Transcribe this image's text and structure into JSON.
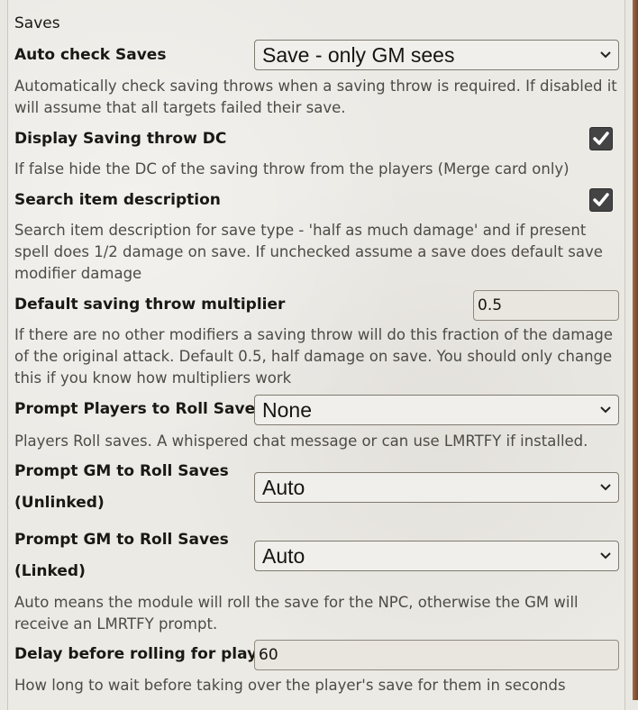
{
  "section": {
    "title": "Saves"
  },
  "settings": {
    "auto_check": {
      "label": "Auto check Saves",
      "value": "Save - only GM sees",
      "hint": "Automatically check saving throws when a saving throw is required. If disabled it will assume that all targets failed their save."
    },
    "display_dc": {
      "label": "Display Saving throw DC",
      "checked": true,
      "hint": "If false hide the DC of the saving throw from the players (Merge card only)"
    },
    "search_desc": {
      "label": "Search item description",
      "checked": true,
      "hint": "Search item description for save type - 'half as much damage' and if present spell does 1/2 damage on save. If unchecked assume a save does default save modifier damage"
    },
    "default_multiplier": {
      "label": "Default saving throw multiplier",
      "value": "0.5",
      "hint": "If there are no other modifiers a saving throw will do this fraction of the damage of the original attack. Default 0.5, half damage on save. You should only change this if you know how multipliers work"
    },
    "prompt_players": {
      "label": "Prompt Players to Roll Saves",
      "value": "None",
      "hint": "Players Roll saves. A whispered chat message or can use LMRTFY if installed."
    },
    "prompt_gm_unlinked": {
      "label_line1": "Prompt GM to Roll Saves",
      "label_line2": "(Unlinked)",
      "value": "Auto"
    },
    "prompt_gm_linked": {
      "label_line1": "Prompt GM to Roll Saves",
      "label_line2": "(Linked)",
      "value": "Auto",
      "hint": "Auto means the module will roll the save for the NPC, otherwise the GM will receive an LMRTFY prompt."
    },
    "delay": {
      "label": "Delay before rolling for players",
      "value": "60",
      "hint": "How long to wait before taking over the player's save for them in seconds"
    }
  },
  "colors": {
    "accent": "#7a4a2e",
    "checkbox": "#444444"
  },
  "icons": {
    "checkbox": "checkmark-icon",
    "dropdown": "chevron-down-icon"
  }
}
